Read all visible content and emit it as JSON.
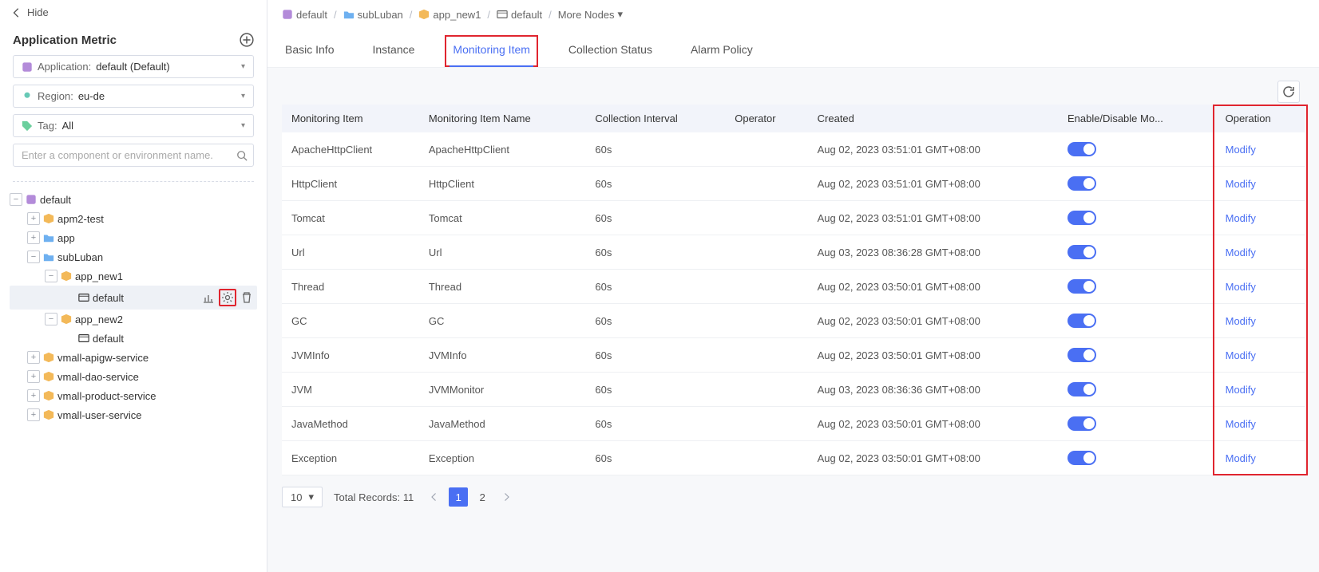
{
  "sidebar": {
    "hide_label": "Hide",
    "header": "Application Metric",
    "filters": {
      "app_label": "Application:",
      "app_value": "default (Default)",
      "region_label": "Region:",
      "region_value": "eu-de",
      "tag_label": "Tag:",
      "tag_value": "All",
      "search_placeholder": "Enter a component or environment name."
    },
    "tree": [
      {
        "level": 0,
        "toggle": "-",
        "icon": "cube-purple",
        "label": "default"
      },
      {
        "level": 1,
        "toggle": "+",
        "icon": "box-orange",
        "label": "apm2-test"
      },
      {
        "level": 1,
        "toggle": "+",
        "icon": "folder-blue",
        "label": "app"
      },
      {
        "level": 1,
        "toggle": "-",
        "icon": "folder-blue",
        "label": "subLuban"
      },
      {
        "level": 2,
        "toggle": "-",
        "icon": "box-orange",
        "label": "app_new1"
      },
      {
        "level": 3,
        "toggle": "",
        "icon": "panel-grey",
        "label": "default",
        "selected": true,
        "show_actions": true
      },
      {
        "level": 2,
        "toggle": "-",
        "icon": "box-orange",
        "label": "app_new2"
      },
      {
        "level": 3,
        "toggle": "",
        "icon": "panel-grey",
        "label": "default"
      },
      {
        "level": 1,
        "toggle": "+",
        "icon": "box-orange",
        "label": "vmall-apigw-service"
      },
      {
        "level": 1,
        "toggle": "+",
        "icon": "box-orange",
        "label": "vmall-dao-service"
      },
      {
        "level": 1,
        "toggle": "+",
        "icon": "box-orange",
        "label": "vmall-product-service"
      },
      {
        "level": 1,
        "toggle": "+",
        "icon": "box-orange",
        "label": "vmall-user-service"
      }
    ]
  },
  "breadcrumb": {
    "items": [
      {
        "icon": "cube-purple",
        "label": "default"
      },
      {
        "icon": "folder-blue",
        "label": "subLuban"
      },
      {
        "icon": "box-orange",
        "label": "app_new1"
      },
      {
        "icon": "panel-grey",
        "label": "default"
      },
      {
        "icon": "",
        "label": "More Nodes",
        "dropdown": true
      }
    ]
  },
  "tabs": [
    "Basic Info",
    "Instance",
    "Monitoring Item",
    "Collection Status",
    "Alarm Policy"
  ],
  "active_tab": 2,
  "table": {
    "headers": [
      "Monitoring Item",
      "Monitoring Item Name",
      "Collection Interval",
      "Operator",
      "Created",
      "Enable/Disable Mo...",
      "Operation"
    ],
    "action_label": "Modify",
    "rows": [
      {
        "item": "ApacheHttpClient",
        "name": "ApacheHttpClient",
        "interval": "60s",
        "operator": "",
        "created": "Aug 02, 2023 03:51:01 GMT+08:00",
        "enabled": true
      },
      {
        "item": "HttpClient",
        "name": "HttpClient",
        "interval": "60s",
        "operator": "",
        "created": "Aug 02, 2023 03:51:01 GMT+08:00",
        "enabled": true
      },
      {
        "item": "Tomcat",
        "name": "Tomcat",
        "interval": "60s",
        "operator": "",
        "created": "Aug 02, 2023 03:51:01 GMT+08:00",
        "enabled": true
      },
      {
        "item": "Url",
        "name": "Url",
        "interval": "60s",
        "operator": "",
        "created": "Aug 03, 2023 08:36:28 GMT+08:00",
        "enabled": true
      },
      {
        "item": "Thread",
        "name": "Thread",
        "interval": "60s",
        "operator": "",
        "created": "Aug 02, 2023 03:50:01 GMT+08:00",
        "enabled": true
      },
      {
        "item": "GC",
        "name": "GC",
        "interval": "60s",
        "operator": "",
        "created": "Aug 02, 2023 03:50:01 GMT+08:00",
        "enabled": true
      },
      {
        "item": "JVMInfo",
        "name": "JVMInfo",
        "interval": "60s",
        "operator": "",
        "created": "Aug 02, 2023 03:50:01 GMT+08:00",
        "enabled": true
      },
      {
        "item": "JVM",
        "name": "JVMMonitor",
        "interval": "60s",
        "operator": "",
        "created": "Aug 03, 2023 08:36:36 GMT+08:00",
        "enabled": true
      },
      {
        "item": "JavaMethod",
        "name": "JavaMethod",
        "interval": "60s",
        "operator": "",
        "created": "Aug 02, 2023 03:50:01 GMT+08:00",
        "enabled": true
      },
      {
        "item": "Exception",
        "name": "Exception",
        "interval": "60s",
        "operator": "",
        "created": "Aug 02, 2023 03:50:01 GMT+08:00",
        "enabled": true
      }
    ]
  },
  "pagination": {
    "page_size": "10",
    "total_label": "Total Records: 11",
    "pages": [
      "1",
      "2"
    ],
    "current": 1
  }
}
